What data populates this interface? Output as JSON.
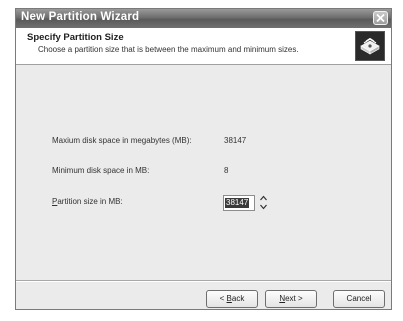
{
  "window": {
    "title": "New Partition Wizard"
  },
  "header": {
    "title": "Specify Partition Size",
    "subtitle": "Choose a partition size that is between the maximum and minimum sizes."
  },
  "fields": {
    "max_label": "Maxium disk space in megabytes (MB):",
    "max_value": "38147",
    "min_label": "Minimum disk space in MB:",
    "min_value": "8",
    "size_label_accel": "P",
    "size_label_rest": "artition size in MB:",
    "size_value": "38147"
  },
  "buttons": {
    "back_pre": "< ",
    "back_accel": "B",
    "back_rest": "ack",
    "next_accel": "N",
    "next_rest": "ext >",
    "cancel": "Cancel"
  },
  "icons": {
    "close": "close-icon",
    "header": "disk-drive-icon",
    "spin_up": "spin-up-icon",
    "spin_down": "spin-down-icon"
  }
}
